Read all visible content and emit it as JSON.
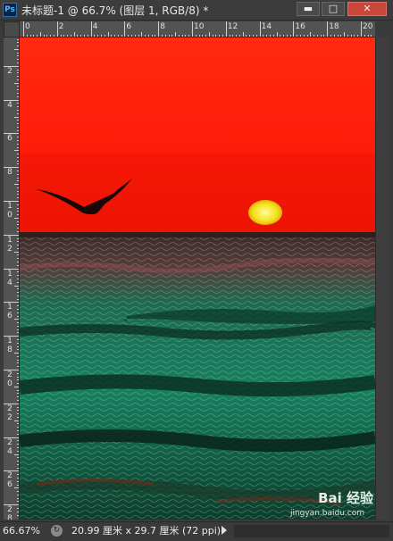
{
  "window": {
    "app_icon": "Ps",
    "title": "未标题-1 @ 66.7% (图层 1, RGB/8) *",
    "minimize_icon": "minimize-icon",
    "maximize_icon": "maximize-icon",
    "close_icon": "close-icon"
  },
  "ruler": {
    "top_labels": [
      "0",
      "2",
      "4",
      "6",
      "8",
      "10",
      "12",
      "14",
      "16",
      "18",
      "20"
    ],
    "left_labels": [
      "2",
      "4",
      "6",
      "8",
      "10",
      "12",
      "14",
      "16",
      "18",
      "20",
      "22",
      "24",
      "26",
      "28"
    ]
  },
  "canvas": {
    "description_colors": {
      "sky": "#ff1e0a",
      "sun": "#f6e71c",
      "sea_dark": "#0b3a2a",
      "sea_light": "#1a8f6a",
      "bird": "#1a0a0a"
    }
  },
  "status": {
    "zoom": "66.67%",
    "doc_size": "20.99 厘米 x 29.7 厘米 (72 ppi)",
    "menu_arrow_icon": "triangle-right-icon"
  },
  "watermark": {
    "text": "Bai 经验",
    "sub": "jingyan.baidu.com"
  }
}
